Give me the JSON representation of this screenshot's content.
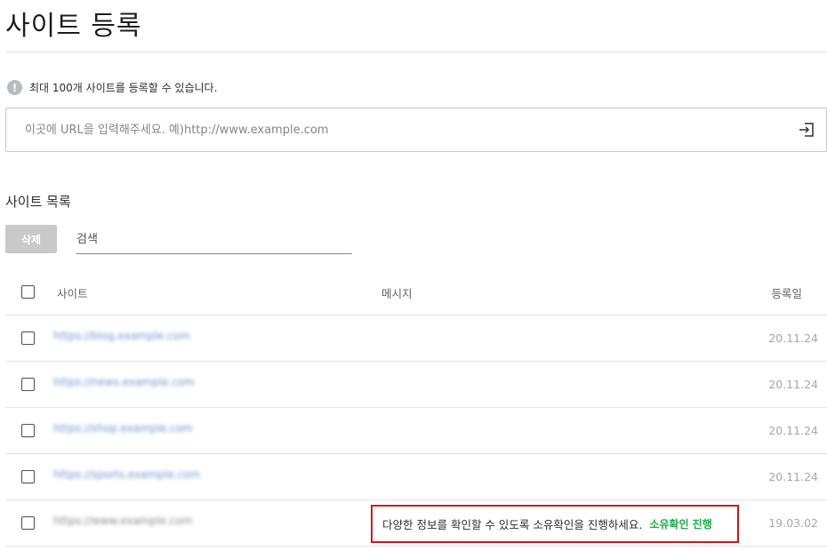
{
  "page": {
    "title": "사이트 등록"
  },
  "notice": {
    "icon": "info-icon",
    "glyph": "!",
    "text": "최대 100개 사이트를 등록할 수 있습니다."
  },
  "url_input": {
    "placeholder": "이곳에 URL을 입력해주세요. 예)http://www.example.com",
    "value": ""
  },
  "site_list": {
    "title": "사이트 목록",
    "delete_label": "삭제",
    "search_placeholder": "검색",
    "columns": {
      "site": "사이트",
      "message": "메시지",
      "date": "등록일"
    },
    "rows": [
      {
        "url": "https://blog.example.com",
        "message": "",
        "date": "20.11.24"
      },
      {
        "url": "https://news.example.com",
        "message": "",
        "date": "20.11.24"
      },
      {
        "url": "https://shop.example.com",
        "message": "",
        "date": "20.11.24"
      },
      {
        "url": "https://sports.example.com",
        "message": "",
        "date": "20.11.24"
      },
      {
        "url": "https://www.example.com",
        "message": "다양한 정보를 확인할 수 있도록 소유확인을 진행하세요.",
        "action": "소유확인 진행",
        "date": "19.03.02"
      }
    ]
  },
  "colors": {
    "verify": "#1fae4b",
    "highlight_border": "#d2191b",
    "delete_button": "#c9c9c9"
  }
}
